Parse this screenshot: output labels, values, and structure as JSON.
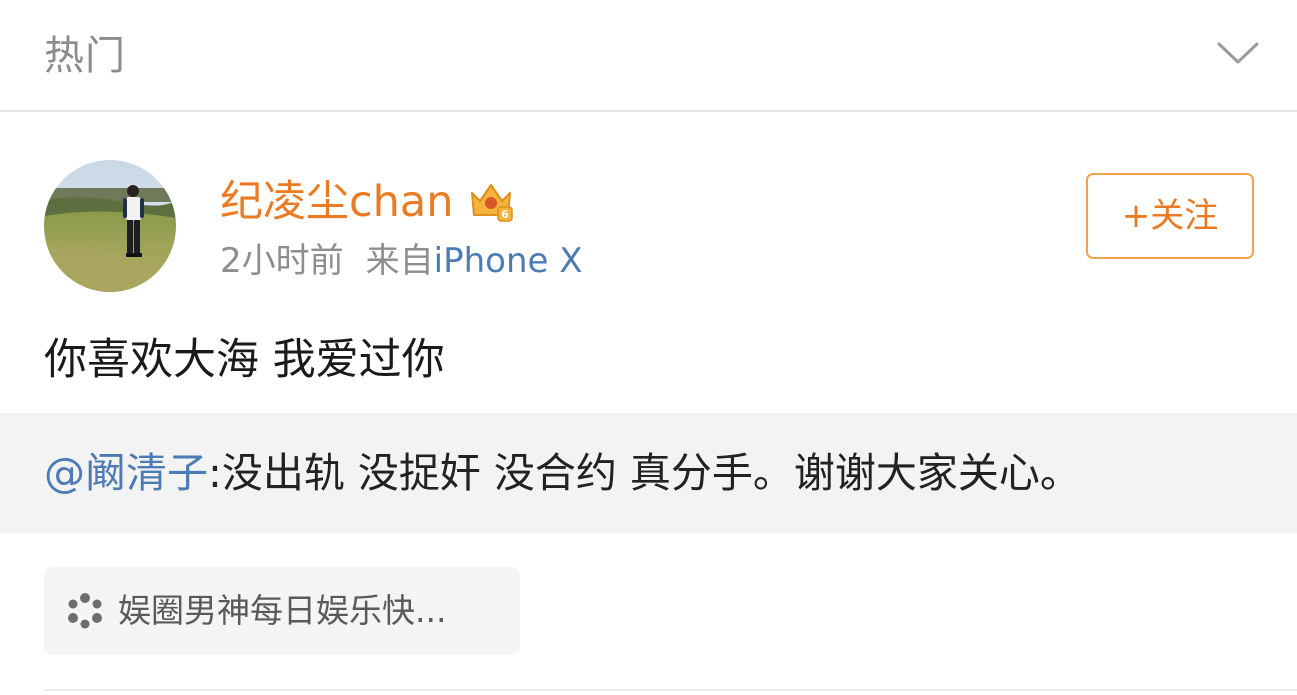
{
  "header": {
    "title": "热门",
    "expand_icon": "chevron-down-icon"
  },
  "post": {
    "author": {
      "name": "纪凌尘chan",
      "badge_icon": "vip-crown-icon",
      "badge_level": "6",
      "avatar_icon": "user-avatar-photo"
    },
    "meta": {
      "time": "2小时前",
      "source_prefix": "来自",
      "device": "iPhone X"
    },
    "follow_label": "+关注",
    "text": "你喜欢大海 我爱过你",
    "repost": {
      "mention": "@阚清子",
      "text": ":没出轨 没捉奸 没合约 真分手。谢谢大家关心。"
    },
    "topic": {
      "icon": "topic-pinwheel-icon",
      "label": "娱圈男神每日娱乐快..."
    }
  },
  "colors": {
    "username": "#eb7b22",
    "link": "#4d7cb4",
    "follow_border": "#f1a24f",
    "meta": "#8e8e8e",
    "repost_bg": "#f3f3f3"
  }
}
